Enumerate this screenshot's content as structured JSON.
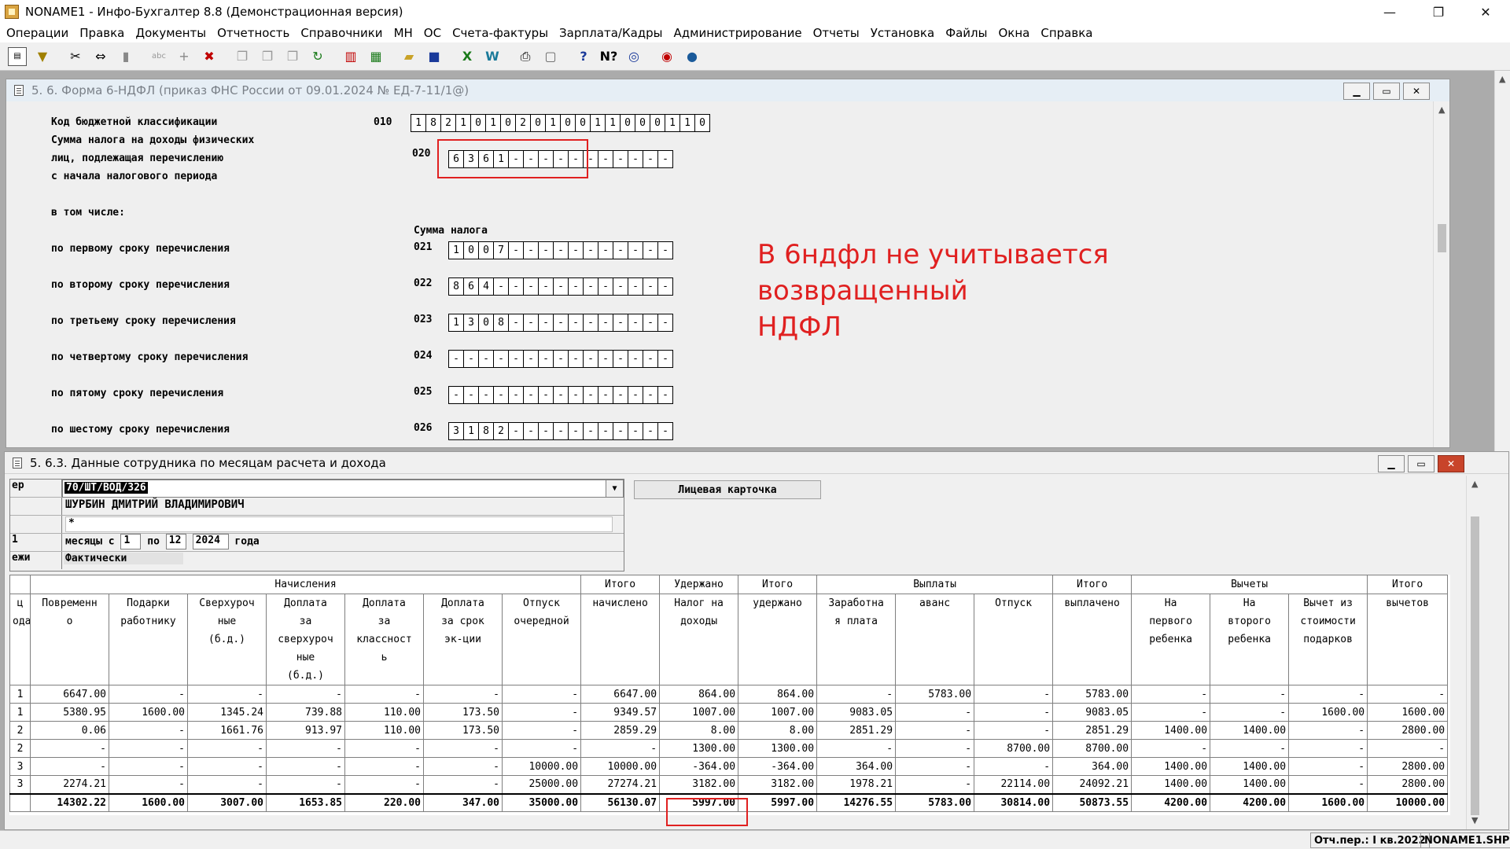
{
  "app": {
    "title": "NONAME1 - Инфо-Бухгалтер 8.8 (Демонстрационная версия)",
    "controls": {
      "minimize": "—",
      "restore": "❐",
      "close": "✕"
    }
  },
  "menu": [
    "Операции",
    "Правка",
    "Документы",
    "Отчетность",
    "Справочники",
    "МН",
    "ОС",
    "Счета-фактуры",
    "Зарплата/Кадры",
    "Администрирование",
    "Отчеты",
    "Установка",
    "Файлы",
    "Окна",
    "Справка"
  ],
  "toolbar_icons": [
    "form-icon",
    "filter-icon",
    "cut-icon",
    "move-icon",
    "paste-icon",
    "text-icon",
    "add-icon",
    "delete-icon",
    "copy-icon",
    "copy2-icon",
    "copy3-icon",
    "refresh-icon",
    "report-icon",
    "calculator-icon",
    "open-folder-icon",
    "save-icon",
    "excel-icon",
    "word-icon",
    "print-icon",
    "preview-icon",
    "help-icon",
    "help-context-icon",
    "navigate-icon",
    "lifebuoy-icon",
    "globe-icon"
  ],
  "form_window": {
    "title": "5. 6. Форма 6-НДФЛ (приказ ФНС России от 09.01.2024 № ЕД-7-11/1@)",
    "kbk": {
      "label": "Код бюджетной классификации",
      "code": "010",
      "digits": [
        "1",
        "8",
        "2",
        "1",
        "0",
        "1",
        "0",
        "2",
        "0",
        "1",
        "0",
        "0",
        "1",
        "1",
        "0",
        "0",
        "0",
        "1",
        "1",
        "0"
      ]
    },
    "tax_sum": {
      "label_lines": [
        "Сумма налога на доходы физических",
        "лиц, подлежащая перечислению",
        "с начала налогового периода"
      ],
      "code": "020",
      "digits": [
        "6",
        "3",
        "6",
        "1",
        "-",
        "-",
        "-",
        "-",
        "-",
        "-",
        "-",
        "-",
        "-",
        "-",
        "-"
      ]
    },
    "including_label": "в том числе:",
    "column_label": "Сумма налога",
    "terms": [
      {
        "label": "по первому сроку перечисления",
        "code": "021",
        "digits": [
          "1",
          "0",
          "0",
          "7",
          "-",
          "-",
          "-",
          "-",
          "-",
          "-",
          "-",
          "-",
          "-",
          "-",
          "-"
        ]
      },
      {
        "label": "по второму сроку перечисления",
        "code": "022",
        "digits": [
          "8",
          "6",
          "4",
          "-",
          "-",
          "-",
          "-",
          "-",
          "-",
          "-",
          "-",
          "-",
          "-",
          "-",
          "-"
        ]
      },
      {
        "label": "по третьему сроку перечисления",
        "code": "023",
        "digits": [
          "1",
          "3",
          "0",
          "8",
          "-",
          "-",
          "-",
          "-",
          "-",
          "-",
          "-",
          "-",
          "-",
          "-",
          "-"
        ]
      },
      {
        "label": "по четвертому сроку перечисления",
        "code": "024",
        "digits": [
          "-",
          "-",
          "-",
          "-",
          "-",
          "-",
          "-",
          "-",
          "-",
          "-",
          "-",
          "-",
          "-",
          "-",
          "-"
        ]
      },
      {
        "label": "по пятому сроку перечисления",
        "code": "025",
        "digits": [
          "-",
          "-",
          "-",
          "-",
          "-",
          "-",
          "-",
          "-",
          "-",
          "-",
          "-",
          "-",
          "-",
          "-",
          "-"
        ]
      },
      {
        "label": "по шестому сроку перечисления",
        "code": "026",
        "digits": [
          "3",
          "1",
          "8",
          "2",
          "-",
          "-",
          "-",
          "-",
          "-",
          "-",
          "-",
          "-",
          "-",
          "-",
          "-"
        ]
      }
    ]
  },
  "annotation": {
    "lines": [
      "В 6ндфл не учитывается возвращенный",
      "НДФЛ"
    ],
    "color": "#e02020"
  },
  "employee_window": {
    "title": "5. 6.3. Данные сотрудника по месяцам расчета и дохода",
    "header": {
      "row1_label": "ер",
      "tab_number": "70/ШТ/ВОД/326",
      "name": "ШУРБИН ДМИТРИЙ ВЛАДИМИРОВИЧ",
      "star": "*",
      "period_prefix": "месяцы  с",
      "month_from": "1",
      "to_label": "по",
      "month_to": "12",
      "year": "2024",
      "year_label": "года",
      "row4_label": "1",
      "row5_label": "ежи",
      "payments_mode": "Фактически"
    },
    "card_button": "Лицевая карточка",
    "table": {
      "group_headers": {
        "accruals": "Начисления",
        "total_accrued": "Итого",
        "withheld": "Удержано",
        "total_withheld": "Итого",
        "payments": "Выплаты",
        "total_paid": "Итого",
        "deductions": "Вычеты",
        "total_deductions": "Итого"
      },
      "sub_headers": {
        "c0": "ц\nода",
        "c1": "Повременн\nо",
        "c2": "Подарки\nработнику",
        "c3": "Сверхуроч\nные\n(б.д.)",
        "c4": "Доплата\nза\nсверхуроч\nные\n(б.д.)",
        "c5": "Доплата\nза\nклассност\nь",
        "c6": "Доплата\nза срок\nэк-ции",
        "c7": "Отпуск\nочередной",
        "c8": "начислено",
        "c9": "Налог на\nдоходы",
        "c10": "удержано",
        "c11": "Заработна\nя плата",
        "c12": "аванс",
        "c13": "Отпуск",
        "c14": "выплачено",
        "c15": "На\nпервого\nребенка",
        "c16": "На\nвторого\nребенка",
        "c17": "Вычет из\nстоимости\nподарков",
        "c18": "вычетов"
      },
      "rows": [
        [
          "1",
          "6647.00",
          "-",
          "-",
          "-",
          "-",
          "-",
          "-",
          "6647.00",
          "864.00",
          "864.00",
          "-",
          "5783.00",
          "-",
          "5783.00",
          "-",
          "-",
          "-",
          "-"
        ],
        [
          "1",
          "5380.95",
          "1600.00",
          "1345.24",
          "739.88",
          "110.00",
          "173.50",
          "-",
          "9349.57",
          "1007.00",
          "1007.00",
          "9083.05",
          "-",
          "-",
          "9083.05",
          "-",
          "-",
          "1600.00",
          "1600.00"
        ],
        [
          "2",
          "0.06",
          "-",
          "1661.76",
          "913.97",
          "110.00",
          "173.50",
          "-",
          "2859.29",
          "8.00",
          "8.00",
          "2851.29",
          "-",
          "-",
          "2851.29",
          "1400.00",
          "1400.00",
          "-",
          "2800.00"
        ],
        [
          "2",
          "-",
          "-",
          "-",
          "-",
          "-",
          "-",
          "-",
          "-",
          "1300.00",
          "1300.00",
          "-",
          "-",
          "8700.00",
          "8700.00",
          "-",
          "-",
          "-",
          "-"
        ],
        [
          "3",
          "-",
          "-",
          "-",
          "-",
          "-",
          "-",
          "10000.00",
          "10000.00",
          "-364.00",
          "-364.00",
          "364.00",
          "-",
          "-",
          "364.00",
          "1400.00",
          "1400.00",
          "-",
          "2800.00"
        ],
        [
          "3",
          "2274.21",
          "-",
          "-",
          "-",
          "-",
          "-",
          "25000.00",
          "27274.21",
          "3182.00",
          "3182.00",
          "1978.21",
          "-",
          "22114.00",
          "24092.21",
          "1400.00",
          "1400.00",
          "-",
          "2800.00"
        ]
      ],
      "total": [
        "",
        "14302.22",
        "1600.00",
        "3007.00",
        "1653.85",
        "220.00",
        "347.00",
        "35000.00",
        "56130.07",
        "5997.00",
        "5997.00",
        "14276.55",
        "5783.00",
        "30814.00",
        "50873.55",
        "4200.00",
        "4200.00",
        "1600.00",
        "10000.00"
      ]
    }
  },
  "status": {
    "period": "Отч.пер.: I кв.2022",
    "file": "NONAME1.SHP"
  }
}
